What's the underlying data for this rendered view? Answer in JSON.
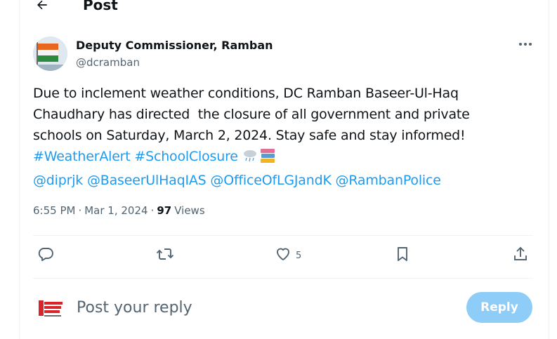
{
  "header": {
    "title": "Post"
  },
  "author": {
    "name": "Deputy Commissioner, Ramban",
    "handle": "@dcramban"
  },
  "tweet": {
    "lines": [
      "Due to inclement weather conditions, DC Ramban Baseer-Ul-Haq",
      "Chaudhary has directed  the closure of all government and private",
      "schools on Saturday, March 2, 2024. Stay safe and stay informed!"
    ],
    "hashtags": [
      "#WeatherAlert",
      "#SchoolClosure"
    ],
    "mentions": [
      "@diprjk",
      "@BaseerUlHaqIAS",
      "@OfficeOfLGJandK",
      "@RambanPolice"
    ]
  },
  "meta": {
    "time": "6:55 PM",
    "separator": "·",
    "date": "Mar 1, 2024",
    "views_count": "97",
    "views_label": "Views"
  },
  "actions": {
    "like_count": "5"
  },
  "reply": {
    "placeholder": "Post your reply",
    "button_label": "Reply"
  },
  "colors": {
    "link": "#1d9bf0",
    "reply_button": "#8ecdf8",
    "muted": "#536471"
  },
  "icons": [
    "back-arrow-icon",
    "more-icon",
    "reply-icon",
    "retweet-icon",
    "like-icon",
    "bookmark-icon",
    "share-icon",
    "rain-cloud-emoji",
    "books-emoji"
  ]
}
